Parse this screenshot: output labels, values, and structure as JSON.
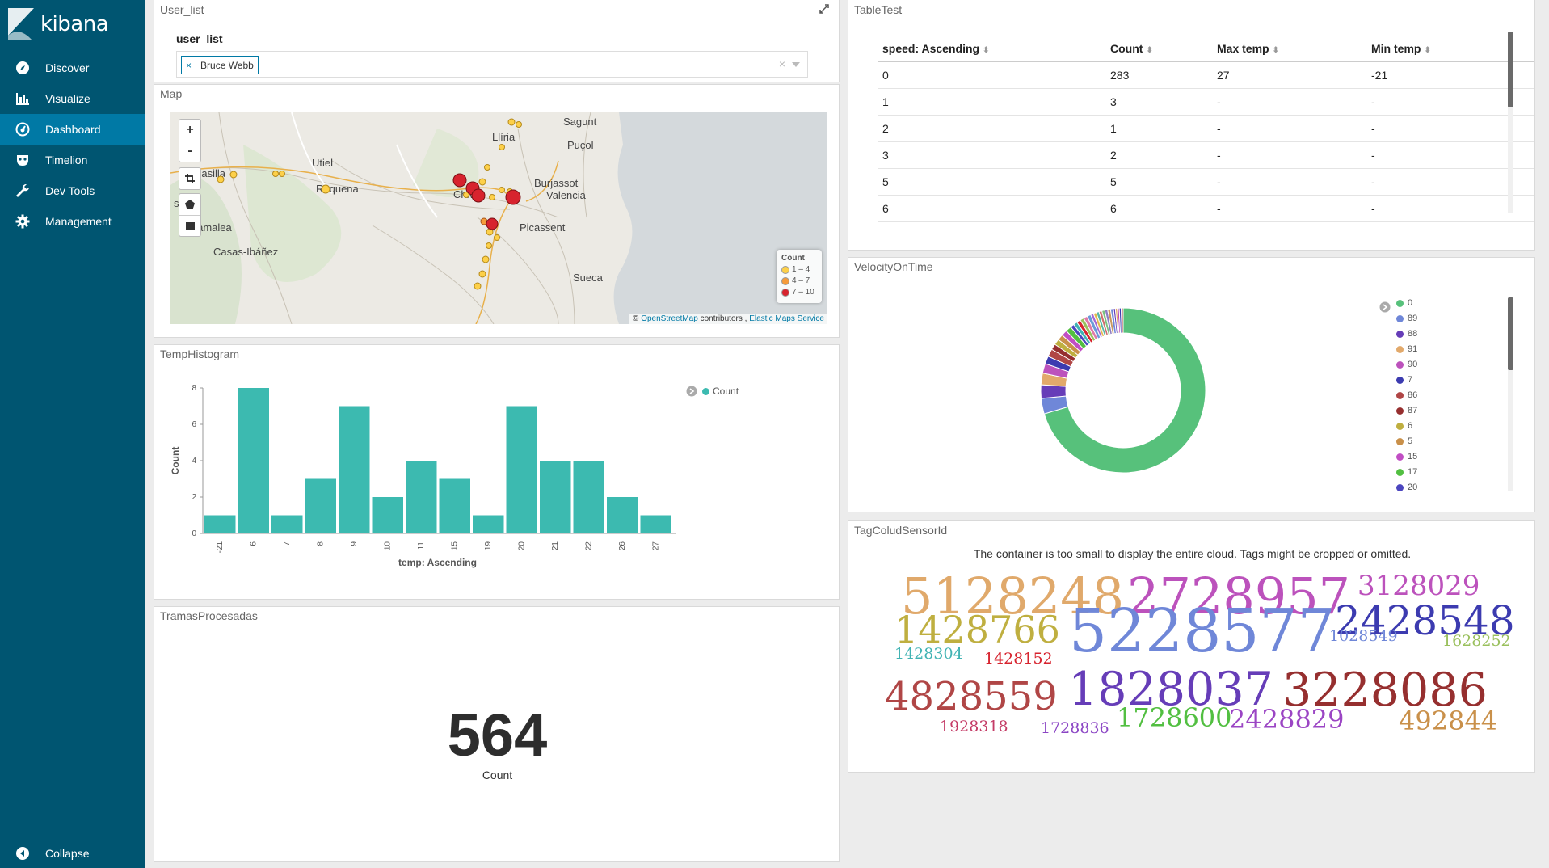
{
  "app": {
    "name": "kibana"
  },
  "nav": {
    "items": [
      {
        "label": "Discover",
        "icon": "compass-icon"
      },
      {
        "label": "Visualize",
        "icon": "bar-chart-icon"
      },
      {
        "label": "Dashboard",
        "icon": "dashboard-icon",
        "active": true
      },
      {
        "label": "Timelion",
        "icon": "mask-icon"
      },
      {
        "label": "Dev Tools",
        "icon": "wrench-icon"
      },
      {
        "label": "Management",
        "icon": "gear-icon"
      }
    ],
    "collapse_label": "Collapse"
  },
  "colors": {
    "sidebar": "#005571",
    "active": "#0079a5",
    "teal": "#3cbab0",
    "donut_main": "#57c17b"
  },
  "user_list": {
    "title": "User_list",
    "label": "user_list",
    "selected_tag": "Bruce Webb",
    "tag_remove": "×",
    "clear": "×"
  },
  "map": {
    "title": "Map",
    "zoom_in": "+",
    "zoom_out": "-",
    "places": [
      "Llíria",
      "Puçol",
      "Sagunt",
      "Utiel",
      "Requena",
      "Chiva",
      "Burjassot",
      "Valencia",
      "Picassent",
      "Villamalea",
      "Casas-Ibáñez",
      "Sueca",
      "nglasilla",
      "s"
    ],
    "legend": {
      "title": "Count",
      "ranges": [
        "1 – 4",
        "4 – 7",
        "7 – 10"
      ],
      "colors": [
        "#fdd049",
        "#f59b3b",
        "#d7232e"
      ]
    },
    "attribution": {
      "prefix": "©",
      "osm": "OpenStreetMap",
      "contributors": "contributors ,",
      "ems": "Elastic Maps Service"
    }
  },
  "temp_histogram": {
    "title": "TempHistogram",
    "legend_label": "Count"
  },
  "tramas": {
    "title": "TramasProcesadas",
    "value": "564",
    "label": "Count"
  },
  "table_test": {
    "title": "TableTest",
    "headers": [
      "speed: Ascending",
      "Count",
      "Max temp",
      "Min temp"
    ],
    "rows": [
      [
        "0",
        "283",
        "27",
        "-21"
      ],
      [
        "1",
        "3",
        "-",
        "-"
      ],
      [
        "2",
        "1",
        "-",
        "-"
      ],
      [
        "3",
        "2",
        "-",
        "-"
      ],
      [
        "5",
        "5",
        "-",
        "-"
      ],
      [
        "6",
        "6",
        "-",
        "-"
      ]
    ]
  },
  "velocity": {
    "title": "VelocityOnTime",
    "legend": [
      {
        "label": "0",
        "color": "#57c17b"
      },
      {
        "label": "89",
        "color": "#6f87d8"
      },
      {
        "label": "88",
        "color": "#663db8"
      },
      {
        "label": "91",
        "color": "#e2a96b"
      },
      {
        "label": "90",
        "color": "#bc52bc"
      },
      {
        "label": "7",
        "color": "#3c3bb0"
      },
      {
        "label": "86",
        "color": "#b04646"
      },
      {
        "label": "87",
        "color": "#962f2f"
      },
      {
        "label": "6",
        "color": "#bfaf40"
      },
      {
        "label": "5",
        "color": "#c9904a"
      },
      {
        "label": "15",
        "color": "#c14ec4"
      },
      {
        "label": "17",
        "color": "#52bf41"
      },
      {
        "label": "20",
        "color": "#4c46bf"
      }
    ]
  },
  "tagcloud": {
    "title": "TagColudSensorId",
    "warning": "The container is too small to display the entire cloud. Tags might be cropped or omitted.",
    "tags": [
      {
        "text": "5128248",
        "color": "#e0a96b"
      },
      {
        "text": "2728957",
        "color": "#bc52bc"
      },
      {
        "text": "3128029",
        "color": "#bc52bc"
      },
      {
        "text": "2428548",
        "color": "#3c3bb0"
      },
      {
        "text": "1428766",
        "color": "#bfaf40"
      },
      {
        "text": "5228577",
        "color": "#6f87d8"
      },
      {
        "text": "1028549",
        "color": "#6f87d8"
      },
      {
        "text": "1628252",
        "color": "#9ac05d"
      },
      {
        "text": "1428304",
        "color": "#40b3b3"
      },
      {
        "text": "1428152",
        "color": "#d7232e"
      },
      {
        "text": "4828559",
        "color": "#b04646"
      },
      {
        "text": "1828037",
        "color": "#663db8"
      },
      {
        "text": "3228086",
        "color": "#962f2f"
      },
      {
        "text": "1728600",
        "color": "#52bf41"
      },
      {
        "text": "2428829",
        "color": "#9b45c4"
      },
      {
        "text": "492844",
        "color": "#c9904a"
      },
      {
        "text": "1928318",
        "color": "#c43b66"
      },
      {
        "text": "1728836",
        "color": "#8b45c4"
      }
    ]
  },
  "chart_data": {
    "type": "bar",
    "categories": [
      "-21",
      "6",
      "7",
      "8",
      "9",
      "10",
      "11",
      "15",
      "19",
      "20",
      "21",
      "22",
      "26",
      "27"
    ],
    "values": [
      1,
      8,
      1,
      3,
      7,
      2,
      4,
      3,
      1,
      7,
      4,
      4,
      2,
      1
    ],
    "xlabel": "temp: Ascending",
    "ylabel": "Count",
    "ylim": [
      0,
      8
    ],
    "yticks": [
      "0",
      "2",
      "4",
      "6",
      "8"
    ],
    "series": [
      {
        "name": "Count",
        "values": [
          1,
          8,
          1,
          3,
          7,
          2,
          4,
          3,
          1,
          7,
          4,
          4,
          2,
          1
        ]
      }
    ],
    "grid": false,
    "legend": "top-right"
  }
}
